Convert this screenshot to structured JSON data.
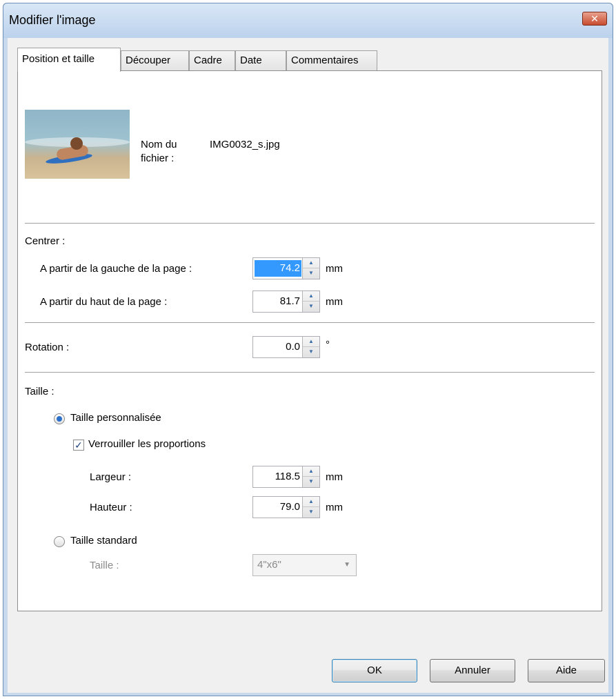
{
  "window": {
    "title": "Modifier l'image",
    "close_glyph": "✕"
  },
  "tabs": [
    {
      "label": "Position et taille",
      "active": true
    },
    {
      "label": "Découper",
      "active": false
    },
    {
      "label": "Cadre",
      "active": false
    },
    {
      "label": "Date",
      "active": false
    },
    {
      "label": "Commentaires",
      "active": false
    }
  ],
  "file": {
    "label_line1": "Nom du",
    "label_line2": "fichier :",
    "name": "IMG0032_s.jpg"
  },
  "center": {
    "heading": "Centrer :",
    "left_label": "A partir de la gauche de la page :",
    "left_value": "74.2",
    "top_label": "A partir du haut de la page :",
    "top_value": "81.7",
    "unit": "mm"
  },
  "rotation": {
    "label": "Rotation :",
    "value": "0.0",
    "unit": "°"
  },
  "size": {
    "heading": "Taille :",
    "custom_label": "Taille personnalisée",
    "custom_selected": true,
    "lock_label": "Verrouiller les proportions",
    "lock_checked": true,
    "width_label": "Largeur :",
    "width_value": "118.5",
    "height_label": "Hauteur :",
    "height_value": "79.0",
    "unit": "mm",
    "standard_label": "Taille standard",
    "standard_selected": false,
    "std_size_label": "Taille :",
    "std_size_value": "4\"x6\""
  },
  "buttons": {
    "ok": "OK",
    "cancel": "Annuler",
    "help": "Aide"
  },
  "colors": {
    "accent": "#3399ff",
    "titlebar": "#c8d9ee",
    "close": "#c84c30"
  }
}
